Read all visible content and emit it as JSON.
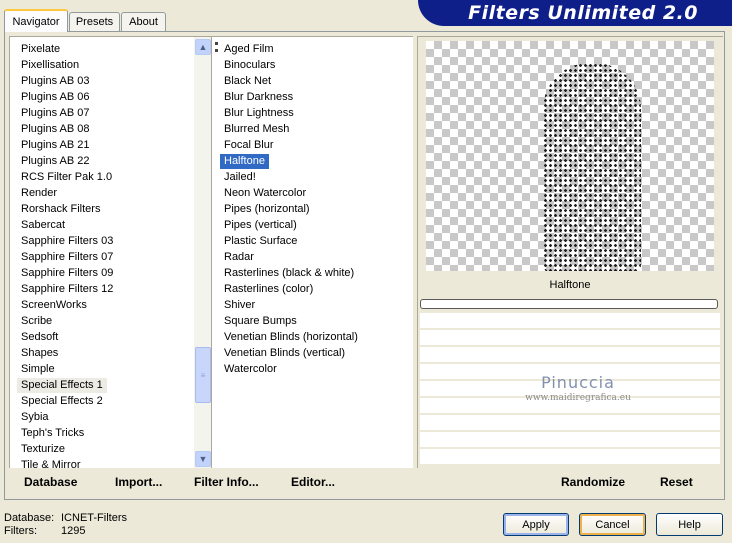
{
  "header": {
    "title": "Filters Unlimited 2.0"
  },
  "tabs": [
    {
      "label": "Navigator",
      "active": true
    },
    {
      "label": "Presets",
      "active": false
    },
    {
      "label": "About",
      "active": false
    }
  ],
  "categories": {
    "items": [
      "Pixelate",
      "Pixellisation",
      "Plugins AB 03",
      "Plugins AB 06",
      "Plugins AB 07",
      "Plugins AB 08",
      "Plugins AB 21",
      "Plugins AB 22",
      "RCS Filter Pak 1.0",
      "Render",
      "Rorshack Filters",
      "Sabercat",
      "Sapphire Filters 03",
      "Sapphire Filters 07",
      "Sapphire Filters 09",
      "Sapphire Filters 12",
      "ScreenWorks",
      "Scribe",
      "Sedsoft",
      "Shapes",
      "Simple",
      "Special Effects 1",
      "Special Effects 2",
      "Sybia",
      "Teph's Tricks",
      "Texturize",
      "Tile & Mirror"
    ],
    "selected": "Special Effects 1"
  },
  "filters": {
    "items": [
      "Aged Film",
      "Binoculars",
      "Black Net",
      "Blur Darkness",
      "Blur Lightness",
      "Blurred Mesh",
      "Focal Blur",
      "Halftone",
      "Jailed!",
      "Neon Watercolor",
      "Pipes (horizontal)",
      "Pipes (vertical)",
      "Plastic Surface",
      "Radar",
      "Rasterlines (black & white)",
      "Rasterlines (color)",
      "Shiver",
      "Square Bumps",
      "Venetian Blinds (horizontal)",
      "Venetian Blinds (vertical)",
      "Watercolor"
    ],
    "selected": "Halftone"
  },
  "preview": {
    "filter_name": "Halftone",
    "progress": 0,
    "watermark_name": "Pinuccia",
    "watermark_url": "www.maidiregrafica.eu"
  },
  "toolbar_left": {
    "database_label": "Database",
    "import_label": "Import...",
    "filter_info_label": "Filter Info...",
    "editor_label": "Editor..."
  },
  "toolbar_right": {
    "randomize_label": "Randomize",
    "reset_label": "Reset"
  },
  "footer": {
    "database_key": "Database:",
    "database_value": "ICNET-Filters",
    "filters_key": "Filters:",
    "filters_value": "1295"
  },
  "buttons": {
    "apply": "Apply",
    "cancel": "Cancel",
    "help": "Help"
  },
  "colors": {
    "banner": "#0f1f8a",
    "selection": "#316ac5",
    "background": "#ece9d8"
  }
}
